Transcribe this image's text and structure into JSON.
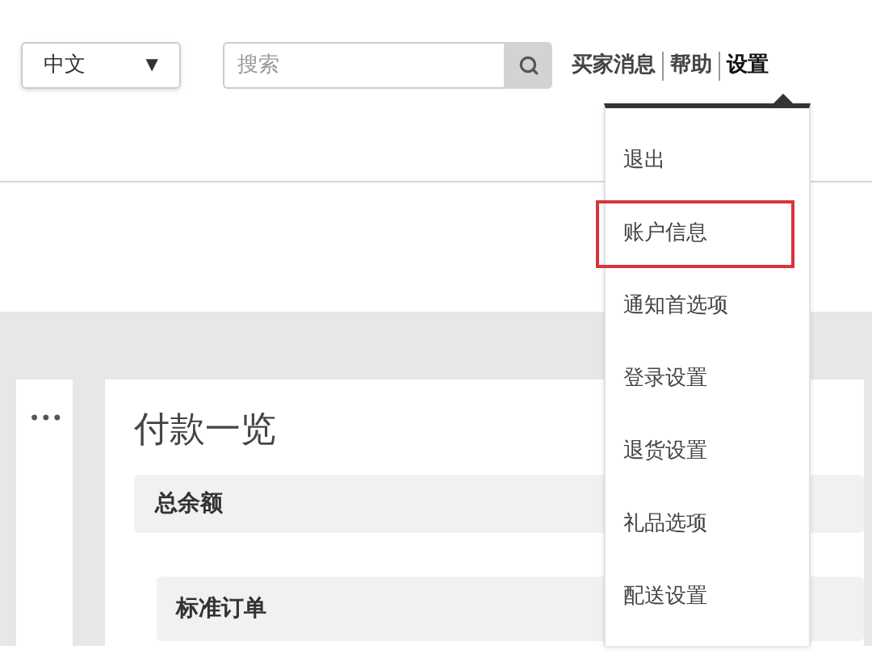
{
  "header": {
    "language_select": {
      "value": "中文",
      "caret": "▼"
    },
    "search": {
      "placeholder": "搜索"
    },
    "links": [
      {
        "label": "买家消息",
        "active": false
      },
      {
        "label": "帮助",
        "active": false
      },
      {
        "label": "设置",
        "active": true
      }
    ]
  },
  "settings_menu": {
    "items": [
      {
        "label": "退出",
        "selected": false
      },
      {
        "label": "账户信息",
        "selected": true
      },
      {
        "label": "通知首选项",
        "selected": false
      },
      {
        "label": "登录设置",
        "selected": false
      },
      {
        "label": "退货设置",
        "selected": false
      },
      {
        "label": "礼品选项",
        "selected": false
      },
      {
        "label": "配送设置",
        "selected": false
      }
    ]
  },
  "side_card": {
    "more": "•••"
  },
  "main_card": {
    "title": "付款一览",
    "sections": [
      "总余额",
      "标准订单"
    ]
  }
}
